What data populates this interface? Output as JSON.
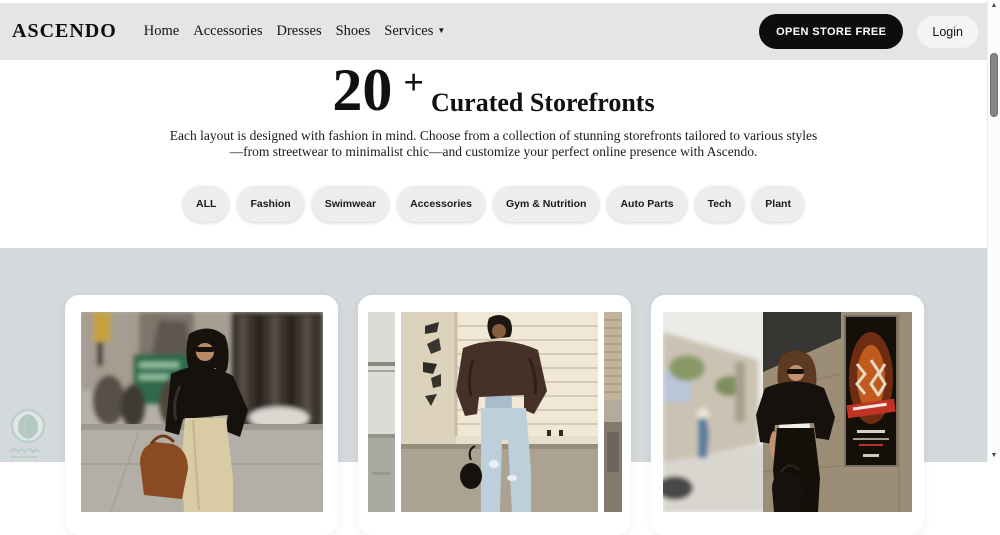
{
  "brand": {
    "logo": "ASCENDO"
  },
  "nav": {
    "items": [
      {
        "label": "Home"
      },
      {
        "label": "Accessories"
      },
      {
        "label": "Dresses"
      },
      {
        "label": "Shoes"
      },
      {
        "label": "Services"
      }
    ]
  },
  "icons": {
    "caret_down": "▼",
    "scroll_up": "▲",
    "scroll_down": "▼",
    "watermark": "leaf-shield-badge"
  },
  "actions": {
    "open_store": "OPEN STORE FREE",
    "login": "Login"
  },
  "hero": {
    "count": "20",
    "plus": "+",
    "title": "Curated Storefronts",
    "description_line1": "Each layout is designed with fashion in mind. Choose from a collection of stunning storefronts tailored to various styles",
    "description_line2": "—from streetwear to minimalist chic—and customize your perfect online presence with Ascendo."
  },
  "filters": [
    "ALL",
    "Fashion",
    "Swimwear",
    "Accessories",
    "Gym & Nutrition",
    "Auto Parts",
    "Tech",
    "Plant"
  ],
  "gallery": {
    "cards": [
      {
        "image": "street-style-model-black-leather-jacket-beige-skirt-city"
      },
      {
        "image": "model-brown-jacket-denim-ripped-jeans-garage-door",
        "carousel": true
      },
      {
        "image": "model-black-jacket-white-blouse-sunny-street-rock-poster"
      }
    ]
  },
  "colors": {
    "navbar_bg": "#e3e5e6",
    "hero_bg": "#ffffff",
    "gallery_bg": "#d4d9dc",
    "dark_button_bg": "#0d0d0d",
    "pill_bg": "#ededed"
  }
}
